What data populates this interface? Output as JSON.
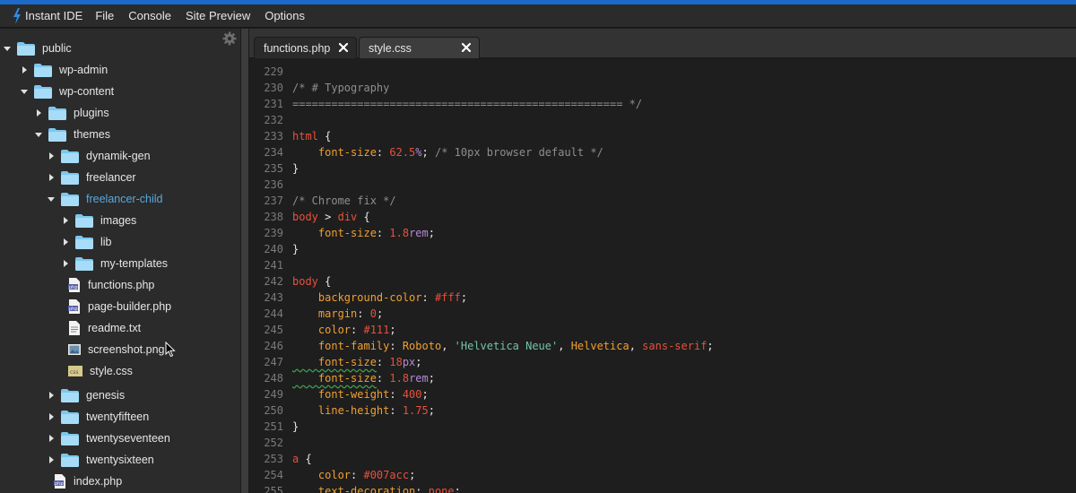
{
  "app": {
    "name": "Instant IDE",
    "brand_color": "#1b6ac9"
  },
  "menu": [
    "File",
    "Console",
    "Site Preview",
    "Options"
  ],
  "sidebar": {
    "tree": [
      {
        "label": "public",
        "type": "folder",
        "open": true
      },
      {
        "label": "wp-admin",
        "type": "folder",
        "open": false
      },
      {
        "label": "wp-content",
        "type": "folder",
        "open": true
      },
      {
        "label": "plugins",
        "type": "folder",
        "open": false
      },
      {
        "label": "themes",
        "type": "folder",
        "open": true
      },
      {
        "label": "dynamik-gen",
        "type": "folder",
        "open": false
      },
      {
        "label": "freelancer",
        "type": "folder",
        "open": false
      },
      {
        "label": "freelancer-child",
        "type": "folder",
        "open": true,
        "active": true
      },
      {
        "label": "images",
        "type": "folder",
        "open": false
      },
      {
        "label": "lib",
        "type": "folder",
        "open": false
      },
      {
        "label": "my-templates",
        "type": "folder",
        "open": false
      },
      {
        "label": "functions.php",
        "type": "php"
      },
      {
        "label": "page-builder.php",
        "type": "php"
      },
      {
        "label": "readme.txt",
        "type": "txt"
      },
      {
        "label": "screenshot.png",
        "type": "png"
      },
      {
        "label": "style.css",
        "type": "css"
      },
      {
        "label": "genesis",
        "type": "folder",
        "open": false
      },
      {
        "label": "twentyfifteen",
        "type": "folder",
        "open": false
      },
      {
        "label": "twentyseventeen",
        "type": "folder",
        "open": false
      },
      {
        "label": "twentysixteen",
        "type": "folder",
        "open": false
      },
      {
        "label": "index.php",
        "type": "php"
      }
    ]
  },
  "tabs": [
    {
      "label": "functions.php",
      "active": false
    },
    {
      "label": "style.css",
      "active": true
    }
  ],
  "editor": {
    "lines": [
      {
        "n": "229",
        "tokens": []
      },
      {
        "n": "230",
        "tokens": [
          {
            "c": "t-comment",
            "t": "/* # Typography"
          }
        ]
      },
      {
        "n": "231",
        "tokens": [
          {
            "c": "t-comment",
            "t": "=================================================== */"
          }
        ]
      },
      {
        "n": "232",
        "tokens": []
      },
      {
        "n": "233",
        "tokens": [
          {
            "c": "t-sel",
            "t": "html"
          },
          {
            "c": "t-brace",
            "t": " {"
          }
        ]
      },
      {
        "n": "234",
        "tokens": [
          {
            "c": "t-prop",
            "t": "    font-size"
          },
          {
            "c": "t-punct",
            "t": ": "
          },
          {
            "c": "t-num",
            "t": "62.5"
          },
          {
            "c": "t-unit",
            "t": "%"
          },
          {
            "c": "t-punct",
            "t": "; "
          },
          {
            "c": "t-comment",
            "t": "/* 10px browser default */"
          }
        ]
      },
      {
        "n": "235",
        "tokens": [
          {
            "c": "t-brace",
            "t": "}"
          }
        ]
      },
      {
        "n": "236",
        "tokens": []
      },
      {
        "n": "237",
        "tokens": [
          {
            "c": "t-comment",
            "t": "/* Chrome fix */"
          }
        ]
      },
      {
        "n": "238",
        "tokens": [
          {
            "c": "t-sel",
            "t": "body"
          },
          {
            "c": "t-punct",
            "t": " > "
          },
          {
            "c": "t-sel",
            "t": "div"
          },
          {
            "c": "t-brace",
            "t": " {"
          }
        ]
      },
      {
        "n": "239",
        "tokens": [
          {
            "c": "t-prop",
            "t": "    font-size"
          },
          {
            "c": "t-punct",
            "t": ": "
          },
          {
            "c": "t-num",
            "t": "1.8"
          },
          {
            "c": "t-unit",
            "t": "rem"
          },
          {
            "c": "t-punct",
            "t": ";"
          }
        ]
      },
      {
        "n": "240",
        "tokens": [
          {
            "c": "t-brace",
            "t": "}"
          }
        ]
      },
      {
        "n": "241",
        "tokens": []
      },
      {
        "n": "242",
        "tokens": [
          {
            "c": "t-sel",
            "t": "body"
          },
          {
            "c": "t-brace",
            "t": " {"
          }
        ]
      },
      {
        "n": "243",
        "tokens": [
          {
            "c": "t-prop",
            "t": "    background-color"
          },
          {
            "c": "t-punct",
            "t": ": "
          },
          {
            "c": "t-num",
            "t": "#fff"
          },
          {
            "c": "t-punct",
            "t": ";"
          }
        ]
      },
      {
        "n": "244",
        "tokens": [
          {
            "c": "t-prop",
            "t": "    margin"
          },
          {
            "c": "t-punct",
            "t": ": "
          },
          {
            "c": "t-num",
            "t": "0"
          },
          {
            "c": "t-punct",
            "t": ";"
          }
        ]
      },
      {
        "n": "245",
        "tokens": [
          {
            "c": "t-prop",
            "t": "    color"
          },
          {
            "c": "t-punct",
            "t": ": "
          },
          {
            "c": "t-num",
            "t": "#111"
          },
          {
            "c": "t-punct",
            "t": ";"
          }
        ]
      },
      {
        "n": "246",
        "tokens": [
          {
            "c": "t-prop",
            "t": "    font-family"
          },
          {
            "c": "t-punct",
            "t": ": "
          },
          {
            "c": "t-kw",
            "t": "Roboto"
          },
          {
            "c": "t-punct",
            "t": ", "
          },
          {
            "c": "t-str",
            "t": "'Helvetica Neue'"
          },
          {
            "c": "t-punct",
            "t": ", "
          },
          {
            "c": "t-kw",
            "t": "Helvetica"
          },
          {
            "c": "t-punct",
            "t": ", "
          },
          {
            "c": "t-num",
            "t": "sans-serif"
          },
          {
            "c": "t-punct",
            "t": ";"
          }
        ]
      },
      {
        "n": "247",
        "tokens": [
          {
            "c": "t-prop squig",
            "t": "    font-size"
          },
          {
            "c": "t-punct",
            "t": ": "
          },
          {
            "c": "t-num",
            "t": "18"
          },
          {
            "c": "t-unit",
            "t": "px"
          },
          {
            "c": "t-punct",
            "t": ";"
          }
        ]
      },
      {
        "n": "248",
        "tokens": [
          {
            "c": "t-prop squig",
            "t": "    font-size"
          },
          {
            "c": "t-punct",
            "t": ": "
          },
          {
            "c": "t-num",
            "t": "1.8"
          },
          {
            "c": "t-unit",
            "t": "rem"
          },
          {
            "c": "t-punct",
            "t": ";"
          }
        ]
      },
      {
        "n": "249",
        "tokens": [
          {
            "c": "t-prop",
            "t": "    font-weight"
          },
          {
            "c": "t-punct",
            "t": ": "
          },
          {
            "c": "t-num",
            "t": "400"
          },
          {
            "c": "t-punct",
            "t": ";"
          }
        ]
      },
      {
        "n": "250",
        "tokens": [
          {
            "c": "t-prop",
            "t": "    line-height"
          },
          {
            "c": "t-punct",
            "t": ": "
          },
          {
            "c": "t-num",
            "t": "1.75"
          },
          {
            "c": "t-punct",
            "t": ";"
          }
        ]
      },
      {
        "n": "251",
        "tokens": [
          {
            "c": "t-brace",
            "t": "}"
          }
        ]
      },
      {
        "n": "252",
        "tokens": []
      },
      {
        "n": "253",
        "tokens": [
          {
            "c": "t-sel",
            "t": "a"
          },
          {
            "c": "t-brace",
            "t": " {"
          }
        ]
      },
      {
        "n": "254",
        "tokens": [
          {
            "c": "t-prop",
            "t": "    color"
          },
          {
            "c": "t-punct",
            "t": ": "
          },
          {
            "c": "t-num",
            "t": "#007acc"
          },
          {
            "c": "t-punct",
            "t": ";"
          }
        ]
      },
      {
        "n": "255",
        "tokens": [
          {
            "c": "t-prop",
            "t": "    text-decoration"
          },
          {
            "c": "t-punct",
            "t": ": "
          },
          {
            "c": "t-num",
            "t": "none"
          },
          {
            "c": "t-punct",
            "t": ";"
          }
        ]
      }
    ]
  }
}
